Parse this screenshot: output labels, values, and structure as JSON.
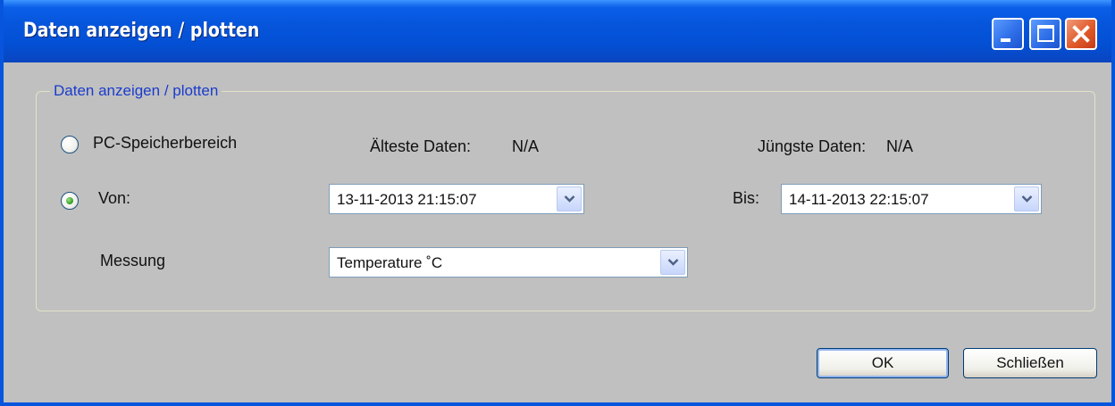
{
  "window": {
    "title": "Daten anzeigen / plotten",
    "controls": {
      "minimize": "minimize-icon",
      "maximize": "maximize-icon",
      "close": "close-icon"
    }
  },
  "group": {
    "legend": "Daten anzeigen / plotten",
    "pc_storage": {
      "label": "PC-Speicherbereich",
      "selected": false
    },
    "oldest": {
      "label": "Älteste Daten:",
      "value": "N/A"
    },
    "newest": {
      "label": "Jüngste Daten:",
      "value": "N/A"
    },
    "from": {
      "label": "Von:",
      "selected": true,
      "value": "13-11-2013 21:15:07"
    },
    "to": {
      "label": "Bis:",
      "value": "14-11-2013 22:15:07"
    },
    "measurement": {
      "label": "Messung",
      "value": "Temperature ˚C"
    }
  },
  "buttons": {
    "ok": "OK",
    "close": "Schließen"
  },
  "colors": {
    "title_bar": "#0a5fe8",
    "dialog_bg": "#c0c0c0",
    "legend_text": "#1a3ccc",
    "close_button": "#e05a2a"
  }
}
